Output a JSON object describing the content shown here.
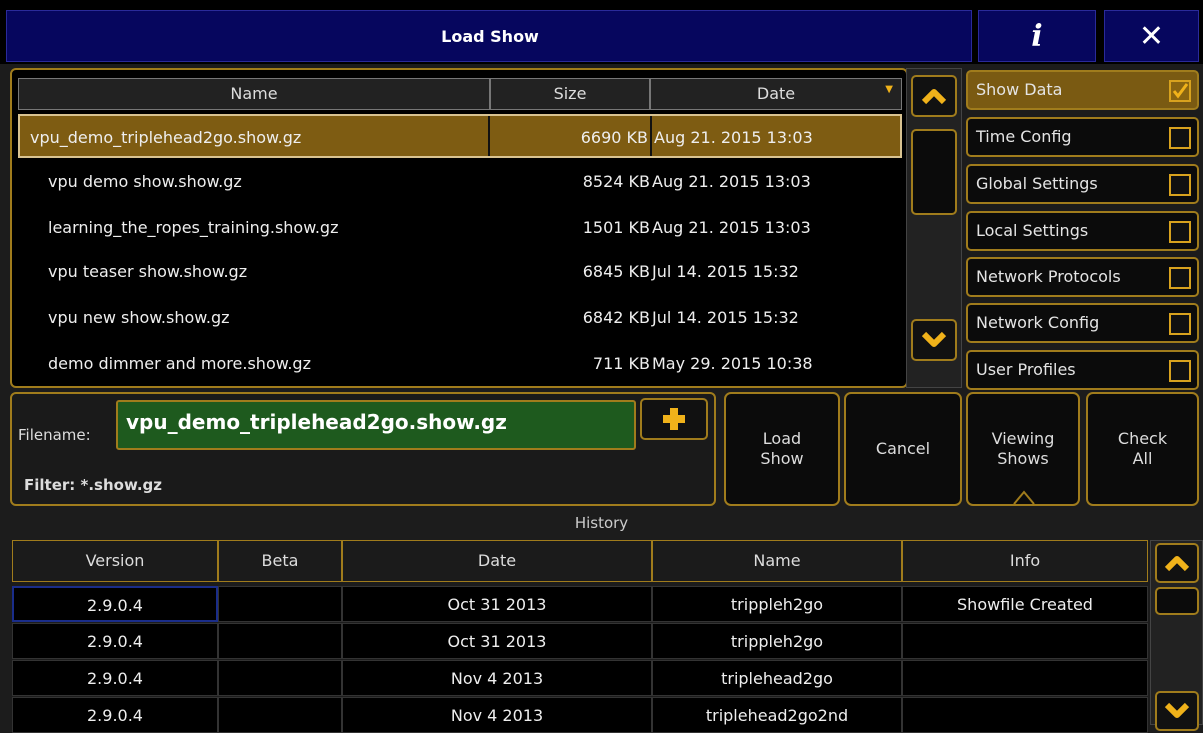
{
  "window": {
    "title": "Load Show",
    "info_button": "i",
    "close_button": "✕"
  },
  "files": {
    "columns": [
      "Name",
      "Size",
      "Date"
    ],
    "rows": [
      {
        "name": "vpu_demo_triplehead2go.show.gz",
        "size": "6690 KB",
        "date": "Aug 21. 2015 13:03"
      },
      {
        "name": "vpu demo show.show.gz",
        "size": "8524 KB",
        "date": "Aug 21. 2015 13:03"
      },
      {
        "name": "learning_the_ropes_training.show.gz",
        "size": "1501 KB",
        "date": "Aug 21. 2015 13:03"
      },
      {
        "name": "vpu teaser show.show.gz",
        "size": "6845 KB",
        "date": "Jul 14. 2015 15:32"
      },
      {
        "name": "vpu new show.show.gz",
        "size": "6842 KB",
        "date": "Jul 14. 2015 15:32"
      },
      {
        "name": "demo dimmer and more.show.gz",
        "size": "711 KB",
        "date": "May 29. 2015 10:38"
      }
    ]
  },
  "options": [
    {
      "label": "Show Data",
      "checked": true
    },
    {
      "label": "Time Config",
      "checked": false
    },
    {
      "label": "Global Settings",
      "checked": false
    },
    {
      "label": "Local Settings",
      "checked": false
    },
    {
      "label": "Network Protocols",
      "checked": false
    },
    {
      "label": "Network Config",
      "checked": false
    },
    {
      "label": "User Profiles",
      "checked": false
    }
  ],
  "filename": {
    "label": "Filename:",
    "value": "vpu_demo_triplehead2go.show.gz",
    "filter": "Filter: *.show.gz"
  },
  "buttons": {
    "load_show_line1": "Load",
    "load_show_line2": "Show",
    "cancel": "Cancel",
    "viewing_shows_line1": "Viewing",
    "viewing_shows_line2": "Shows",
    "check_all_line1": "Check",
    "check_all_line2": "All"
  },
  "history": {
    "title": "History",
    "columns": [
      "Version",
      "Beta",
      "Date",
      "Name",
      "Info"
    ],
    "rows": [
      {
        "version": "2.9.0.4",
        "beta": "",
        "date": "Oct 31 2013",
        "name": "trippleh2go",
        "info": "Showfile Created"
      },
      {
        "version": "2.9.0.4",
        "beta": "",
        "date": "Oct 31 2013",
        "name": "trippleh2go",
        "info": ""
      },
      {
        "version": "2.9.0.4",
        "beta": "",
        "date": "Nov 4 2013",
        "name": "triplehead2go",
        "info": ""
      },
      {
        "version": "2.9.0.4",
        "beta": "",
        "date": "Nov 4 2013",
        "name": "triplehead2go2nd",
        "info": ""
      }
    ]
  },
  "colors": {
    "accent": "#a07c1c",
    "selected_row": "#7e5c12",
    "filename_bg": "#1e5a1e",
    "title_bg": "#06065e",
    "arrow": "#f0b21a"
  },
  "icons": {
    "scroll_up": "chevron-up-icon",
    "scroll_down": "chevron-down-icon",
    "add": "plus-icon",
    "info": "info-icon",
    "close": "close-icon"
  }
}
